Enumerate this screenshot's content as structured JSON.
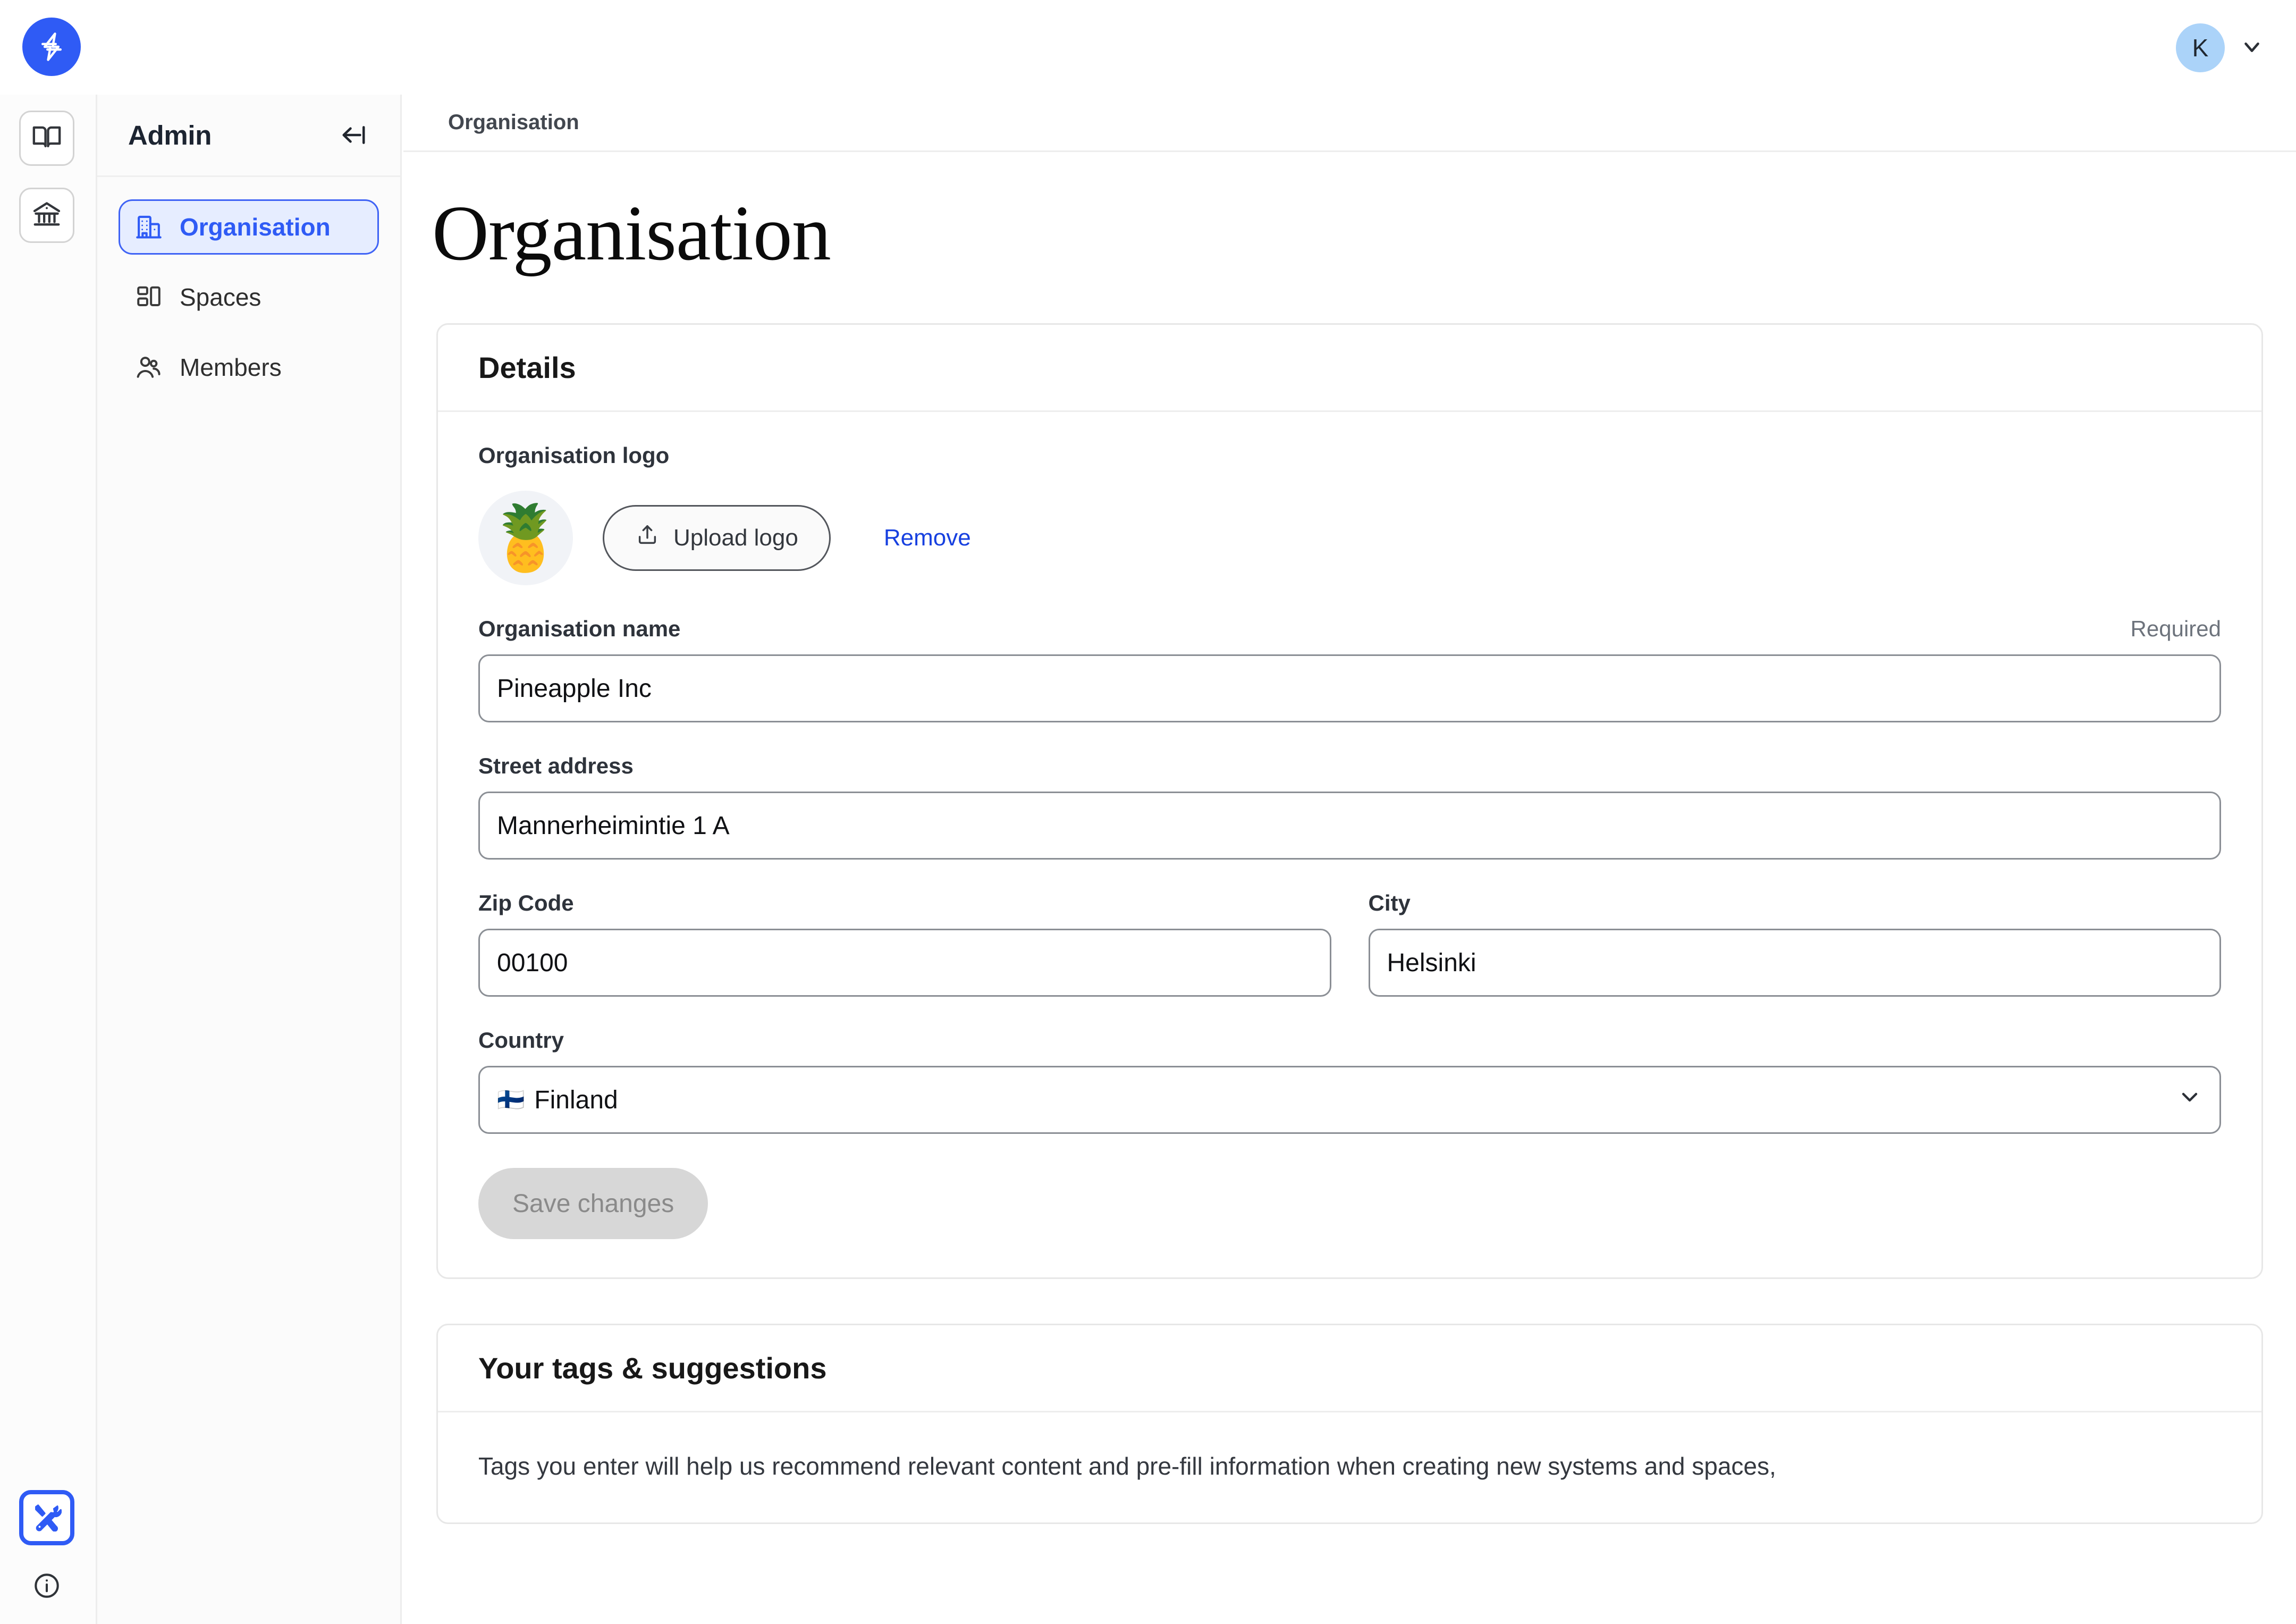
{
  "topbar": {
    "brand_icon": "lightning-bolt-logo",
    "avatar_initial": "K",
    "avatar_color": "#abd3f9",
    "chevron_icon": "chevron-down-icon"
  },
  "rail": {
    "items": [
      {
        "icon": "book-icon",
        "active": false
      },
      {
        "icon": "institution-icon",
        "active": false
      },
      {
        "icon": "tools-icon",
        "active": true
      }
    ],
    "info_icon": "info-circle-icon"
  },
  "admin": {
    "title": "Admin",
    "collapse_icon": "collapse-left-icon",
    "nav": [
      {
        "label": "Organisation",
        "icon": "building-icon",
        "active": true
      },
      {
        "label": "Spaces",
        "icon": "layout-grid-icon",
        "active": false
      },
      {
        "label": "Members",
        "icon": "users-icon",
        "active": false
      }
    ]
  },
  "content": {
    "breadcrumb": "Organisation",
    "page_title": "Organisation",
    "details_card": {
      "title": "Details",
      "logo_label": "Organisation logo",
      "logo_emoji": "🍍",
      "upload_label": "Upload logo",
      "upload_icon": "upload-icon",
      "remove_label": "Remove",
      "name_label": "Organisation name",
      "name_required": "Required",
      "name_value": "Pineapple Inc",
      "street_label": "Street address",
      "street_value": "Mannerheimintie 1 A",
      "zip_label": "Zip Code",
      "zip_value": "00100",
      "city_label": "City",
      "city_value": "Helsinki",
      "country_label": "Country",
      "country_flag": "🇫🇮",
      "country_value": "Finland",
      "country_chevron": "chevron-down-icon",
      "save_label": "Save changes"
    },
    "tags_card": {
      "title": "Your tags & suggestions",
      "description": "Tags you enter will help us recommend relevant content and pre-fill information when creating new systems and spaces,"
    }
  },
  "colors": {
    "accent": "#2f5bf5",
    "link": "#1740e0",
    "nav_active_bg": "#e6edff",
    "avatar_bg": "#abd3f9"
  }
}
